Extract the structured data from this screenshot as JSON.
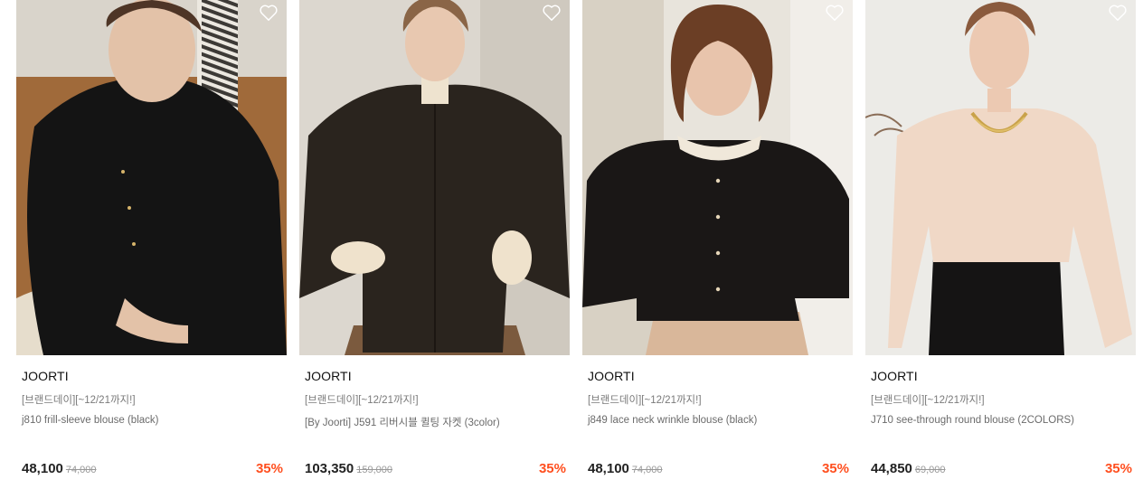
{
  "products": [
    {
      "brand": "JOORTI",
      "promo": "[브랜드데이][~12/21까지!]",
      "name": "j810 frill-sleeve blouse (black)",
      "price": "48,100",
      "original_price": "74,000",
      "discount": "35%"
    },
    {
      "brand": "JOORTI",
      "promo": "[브랜드데이][~12/21까지!]",
      "name": "[By Joorti] J591 리버시블 퀼팅 자켓 (3color)",
      "price": "103,350",
      "original_price": "159,000",
      "discount": "35%"
    },
    {
      "brand": "JOORTI",
      "promo": "[브랜드데이][~12/21까지!]",
      "name": "j849 lace neck wrinkle blouse (black)",
      "price": "48,100",
      "original_price": "74,000",
      "discount": "35%"
    },
    {
      "brand": "JOORTI",
      "promo": "[브랜드데이][~12/21까지!]",
      "name": "J710 see-through round blouse (2COLORS)",
      "price": "44,850",
      "original_price": "69,000",
      "discount": "35%"
    }
  ],
  "colors": {
    "discount": "#ff4f1f",
    "price": "#222222",
    "original_price": "#999999"
  },
  "icons": {
    "wishlist": "heart-outline-icon"
  }
}
